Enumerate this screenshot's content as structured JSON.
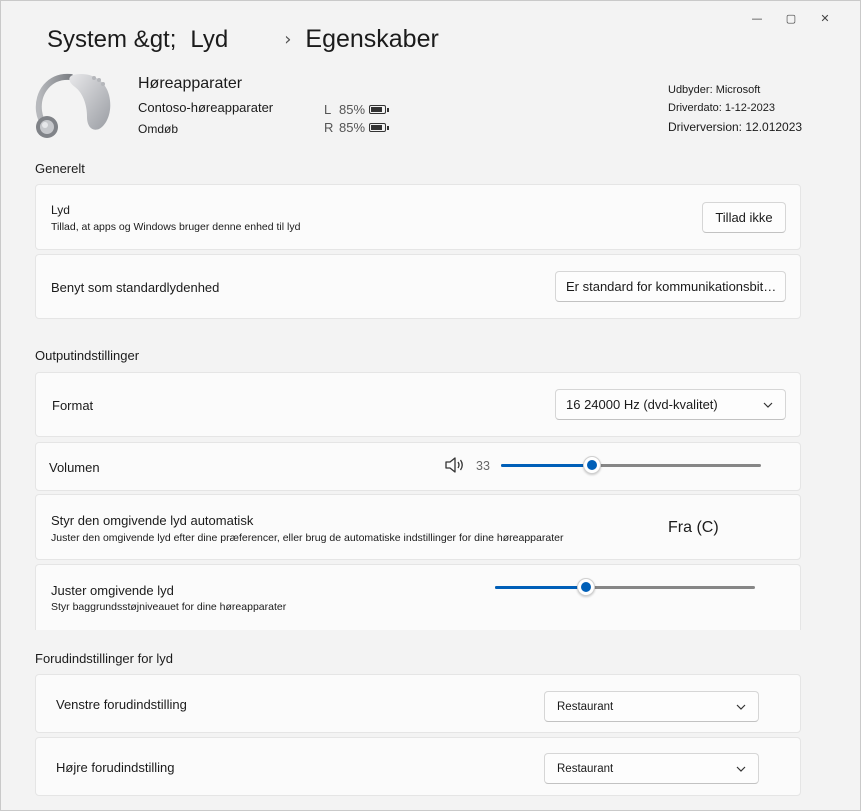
{
  "window": {
    "minimize_glyph": "—",
    "maximize_glyph": "▢",
    "close_glyph": "✕"
  },
  "breadcrumb": {
    "first": "System &gt;",
    "second": "Lyd",
    "separator": "›",
    "current": "Egenskaber"
  },
  "device": {
    "icon": "hearing-aid-icon",
    "name": "Høreapparater",
    "model": "Contoso-høreapparater",
    "rename": "Omdøb",
    "battery": [
      {
        "side": "L",
        "percent": "85%",
        "level": 0.85
      },
      {
        "side": "R",
        "percent": "85%",
        "level": 0.85
      }
    ],
    "provider": "Udbyder: Microsoft",
    "driver_date": "Driverdato: 1-12-2023",
    "driver_version": "Driverversion: 12.012023"
  },
  "general": {
    "title": "Generelt",
    "audio": {
      "title": "Lyd",
      "subtitle": "Tillad, at apps og Windows bruger denne enhed til lyd",
      "button": "Tillad ikke"
    },
    "default_device": {
      "title": "Benyt som standardlydenhed",
      "selected": "Er standard for kommunikationsbit…"
    }
  },
  "output": {
    "title": "Outputindstillinger",
    "format": {
      "title": "Format",
      "selected": "16 24000 Hz (dvd-kvalitet)"
    },
    "volume": {
      "title": "Volumen",
      "value": "33",
      "level": 0.35
    },
    "ambient_auto": {
      "title": "Styr den omgivende lyd automatisk",
      "subtitle": "Juster den omgivende lyd efter dine præferencer, eller brug de automatiske indstillinger for dine høreapparater",
      "state": "Fra (C)"
    },
    "ambient_adjust": {
      "title": "Juster omgivende lyd",
      "subtitle": "Styr baggrundsstøjniveauet for dine høreapparater",
      "level": 0.35
    }
  },
  "presets": {
    "title": "Forudindstillinger for lyd",
    "left": {
      "title": "Venstre forudindstilling",
      "selected": "Restaurant"
    },
    "right": {
      "title": "Højre forudindstilling",
      "selected": "Restaurant"
    }
  },
  "colors": {
    "accent": "#005fb8",
    "background": "#f3f3f3",
    "card": "#fbfbfb"
  }
}
